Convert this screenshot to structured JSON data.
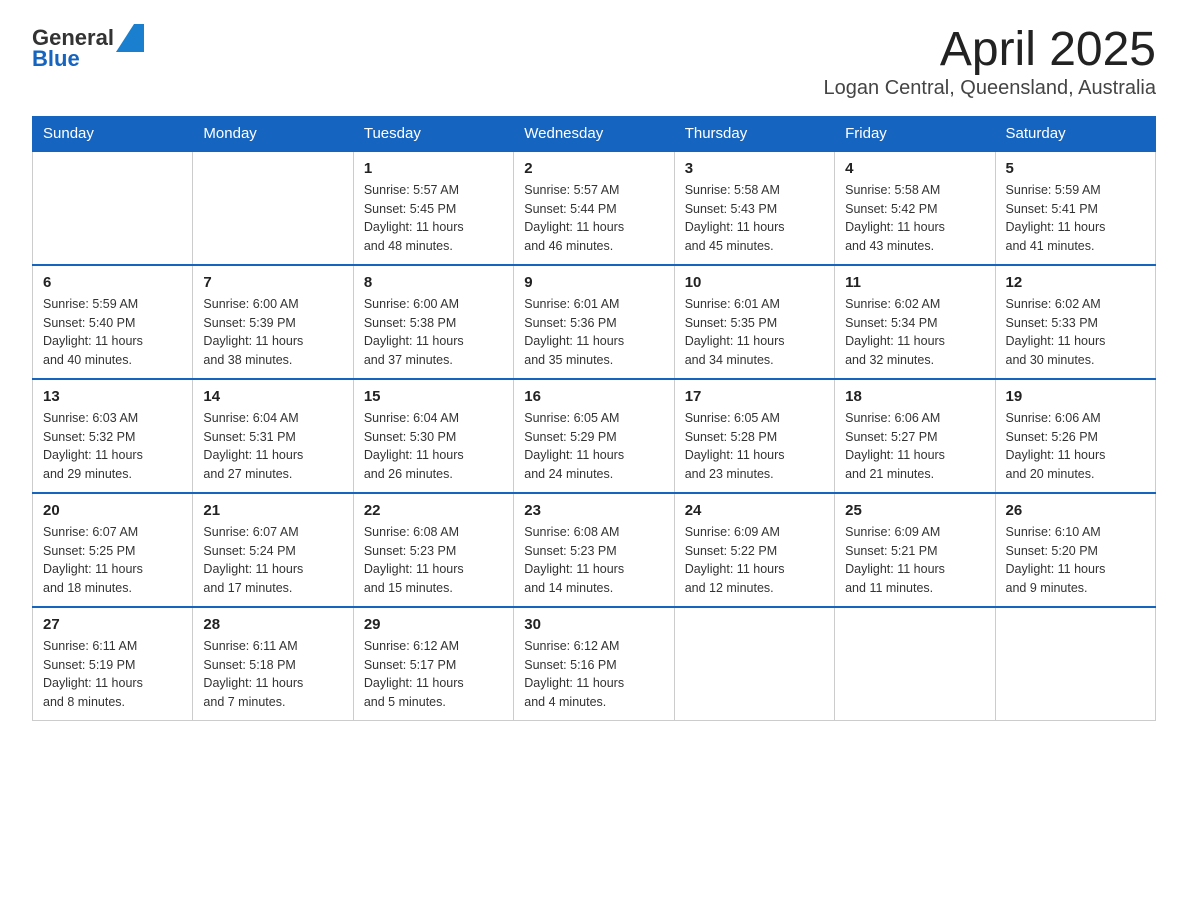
{
  "header": {
    "logo_general": "General",
    "logo_blue": "Blue",
    "title": "April 2025",
    "subtitle": "Logan Central, Queensland, Australia"
  },
  "weekdays": [
    "Sunday",
    "Monday",
    "Tuesday",
    "Wednesday",
    "Thursday",
    "Friday",
    "Saturday"
  ],
  "weeks": [
    [
      {
        "day": "",
        "info": ""
      },
      {
        "day": "",
        "info": ""
      },
      {
        "day": "1",
        "info": "Sunrise: 5:57 AM\nSunset: 5:45 PM\nDaylight: 11 hours\nand 48 minutes."
      },
      {
        "day": "2",
        "info": "Sunrise: 5:57 AM\nSunset: 5:44 PM\nDaylight: 11 hours\nand 46 minutes."
      },
      {
        "day": "3",
        "info": "Sunrise: 5:58 AM\nSunset: 5:43 PM\nDaylight: 11 hours\nand 45 minutes."
      },
      {
        "day": "4",
        "info": "Sunrise: 5:58 AM\nSunset: 5:42 PM\nDaylight: 11 hours\nand 43 minutes."
      },
      {
        "day": "5",
        "info": "Sunrise: 5:59 AM\nSunset: 5:41 PM\nDaylight: 11 hours\nand 41 minutes."
      }
    ],
    [
      {
        "day": "6",
        "info": "Sunrise: 5:59 AM\nSunset: 5:40 PM\nDaylight: 11 hours\nand 40 minutes."
      },
      {
        "day": "7",
        "info": "Sunrise: 6:00 AM\nSunset: 5:39 PM\nDaylight: 11 hours\nand 38 minutes."
      },
      {
        "day": "8",
        "info": "Sunrise: 6:00 AM\nSunset: 5:38 PM\nDaylight: 11 hours\nand 37 minutes."
      },
      {
        "day": "9",
        "info": "Sunrise: 6:01 AM\nSunset: 5:36 PM\nDaylight: 11 hours\nand 35 minutes."
      },
      {
        "day": "10",
        "info": "Sunrise: 6:01 AM\nSunset: 5:35 PM\nDaylight: 11 hours\nand 34 minutes."
      },
      {
        "day": "11",
        "info": "Sunrise: 6:02 AM\nSunset: 5:34 PM\nDaylight: 11 hours\nand 32 minutes."
      },
      {
        "day": "12",
        "info": "Sunrise: 6:02 AM\nSunset: 5:33 PM\nDaylight: 11 hours\nand 30 minutes."
      }
    ],
    [
      {
        "day": "13",
        "info": "Sunrise: 6:03 AM\nSunset: 5:32 PM\nDaylight: 11 hours\nand 29 minutes."
      },
      {
        "day": "14",
        "info": "Sunrise: 6:04 AM\nSunset: 5:31 PM\nDaylight: 11 hours\nand 27 minutes."
      },
      {
        "day": "15",
        "info": "Sunrise: 6:04 AM\nSunset: 5:30 PM\nDaylight: 11 hours\nand 26 minutes."
      },
      {
        "day": "16",
        "info": "Sunrise: 6:05 AM\nSunset: 5:29 PM\nDaylight: 11 hours\nand 24 minutes."
      },
      {
        "day": "17",
        "info": "Sunrise: 6:05 AM\nSunset: 5:28 PM\nDaylight: 11 hours\nand 23 minutes."
      },
      {
        "day": "18",
        "info": "Sunrise: 6:06 AM\nSunset: 5:27 PM\nDaylight: 11 hours\nand 21 minutes."
      },
      {
        "day": "19",
        "info": "Sunrise: 6:06 AM\nSunset: 5:26 PM\nDaylight: 11 hours\nand 20 minutes."
      }
    ],
    [
      {
        "day": "20",
        "info": "Sunrise: 6:07 AM\nSunset: 5:25 PM\nDaylight: 11 hours\nand 18 minutes."
      },
      {
        "day": "21",
        "info": "Sunrise: 6:07 AM\nSunset: 5:24 PM\nDaylight: 11 hours\nand 17 minutes."
      },
      {
        "day": "22",
        "info": "Sunrise: 6:08 AM\nSunset: 5:23 PM\nDaylight: 11 hours\nand 15 minutes."
      },
      {
        "day": "23",
        "info": "Sunrise: 6:08 AM\nSunset: 5:23 PM\nDaylight: 11 hours\nand 14 minutes."
      },
      {
        "day": "24",
        "info": "Sunrise: 6:09 AM\nSunset: 5:22 PM\nDaylight: 11 hours\nand 12 minutes."
      },
      {
        "day": "25",
        "info": "Sunrise: 6:09 AM\nSunset: 5:21 PM\nDaylight: 11 hours\nand 11 minutes."
      },
      {
        "day": "26",
        "info": "Sunrise: 6:10 AM\nSunset: 5:20 PM\nDaylight: 11 hours\nand 9 minutes."
      }
    ],
    [
      {
        "day": "27",
        "info": "Sunrise: 6:11 AM\nSunset: 5:19 PM\nDaylight: 11 hours\nand 8 minutes."
      },
      {
        "day": "28",
        "info": "Sunrise: 6:11 AM\nSunset: 5:18 PM\nDaylight: 11 hours\nand 7 minutes."
      },
      {
        "day": "29",
        "info": "Sunrise: 6:12 AM\nSunset: 5:17 PM\nDaylight: 11 hours\nand 5 minutes."
      },
      {
        "day": "30",
        "info": "Sunrise: 6:12 AM\nSunset: 5:16 PM\nDaylight: 11 hours\nand 4 minutes."
      },
      {
        "day": "",
        "info": ""
      },
      {
        "day": "",
        "info": ""
      },
      {
        "day": "",
        "info": ""
      }
    ]
  ]
}
